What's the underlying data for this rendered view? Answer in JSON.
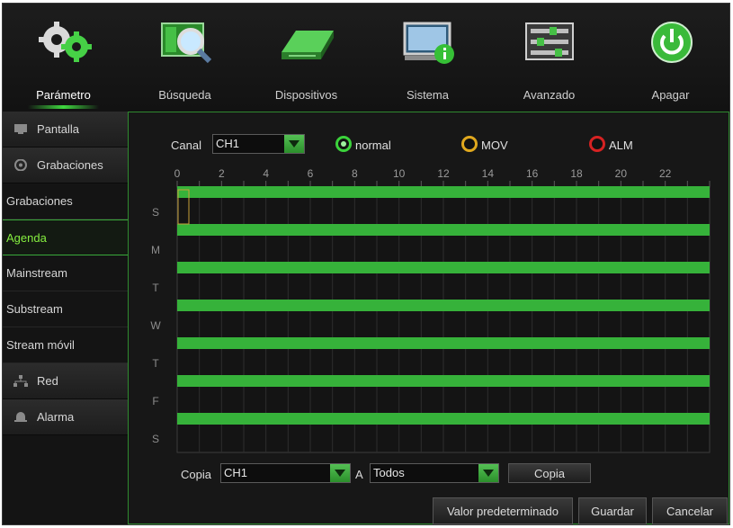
{
  "nav": {
    "items": [
      {
        "label": "Parámetro",
        "icon": "gears-icon"
      },
      {
        "label": "Búsqueda",
        "icon": "search-icon"
      },
      {
        "label": "Dispositivos",
        "icon": "hard-disk-icon"
      },
      {
        "label": "Sistema",
        "icon": "monitor-info-icon"
      },
      {
        "label": "Avanzado",
        "icon": "sliders-icon"
      },
      {
        "label": "Apagar",
        "icon": "power-icon"
      }
    ],
    "active_index": 0
  },
  "sidebar": {
    "items": [
      {
        "label": "Pantalla",
        "type": "group",
        "icon": "display-icon"
      },
      {
        "label": "Grabaciones",
        "type": "group",
        "icon": "record-icon"
      },
      {
        "label": "Grabaciones",
        "type": "sub"
      },
      {
        "label": "Agenda",
        "type": "sub",
        "active": true
      },
      {
        "label": "Mainstream",
        "type": "sub"
      },
      {
        "label": "Substream",
        "type": "sub"
      },
      {
        "label": "Stream móvil",
        "type": "sub"
      },
      {
        "label": "Red",
        "type": "group",
        "icon": "network-icon"
      },
      {
        "label": "Alarma",
        "type": "group",
        "icon": "alarm-icon"
      }
    ]
  },
  "schedule": {
    "channel_label": "Canal",
    "channel_value": "CH1",
    "modes": [
      {
        "label": "normal",
        "color": "#3bd23b",
        "checked": true
      },
      {
        "label": "MOV",
        "color": "#e0a81e",
        "checked": false
      },
      {
        "label": "ALM",
        "color": "#d62222",
        "checked": false
      }
    ],
    "hour_labels": [
      "0",
      "2",
      "4",
      "6",
      "8",
      "10",
      "12",
      "14",
      "16",
      "18",
      "20",
      "22"
    ],
    "days": [
      "S",
      "M",
      "T",
      "W",
      "T",
      "F",
      "S"
    ],
    "recording_color": "#36b23a",
    "recording_hours": [
      0,
      24
    ]
  },
  "copy": {
    "label": "Copia",
    "from_value": "CH1",
    "to_label": "A",
    "to_value": "Todos",
    "button": "Copia"
  },
  "footer": {
    "default_button": "Valor predeterminado",
    "save_button": "Guardar",
    "cancel_button": "Cancelar"
  }
}
